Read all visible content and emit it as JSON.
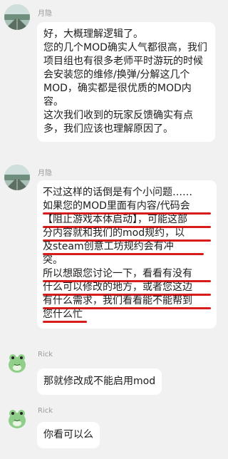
{
  "messages": [
    {
      "sender": "月隐",
      "paragraphs": [
        "好，大概理解逻辑了。",
        "您的几个MOD确实人气都很高，我们项目组也有很多老师平时游玩的时候会安装您的维修/换弹/分解这几个MOD，确实都是很优质的MOD内容。",
        "这次我们收到的玩家反馈确实有点多，我们应该也理解原因了。"
      ]
    },
    {
      "sender": "月隐",
      "lines": [
        "不过这样的话倒是有个小问题……",
        "如果您的MOD里面有内容/代码会",
        "【阻止游戏本体启动】，可能这部",
        "分内容就和我们的mod规约，以",
        "及steam创意工坊规约会有冲",
        "突。",
        "所以想跟您讨论一下，看看有没有",
        "什么可以修改的地方，或者您这边",
        "有什么需求，我们看看能不能帮到",
        "您什么忙"
      ]
    },
    {
      "sender": "Rick",
      "text": "那就修改成不能启用mod"
    },
    {
      "sender": "Rick",
      "text": "你看可以么"
    }
  ],
  "colors": {
    "underline": "#d81b1b",
    "background": "#f1f1f1",
    "bubble": "#ffffff"
  },
  "icons": {
    "avatar1": "landscape-avatar-icon",
    "avatar2": "frog-avatar-icon"
  }
}
